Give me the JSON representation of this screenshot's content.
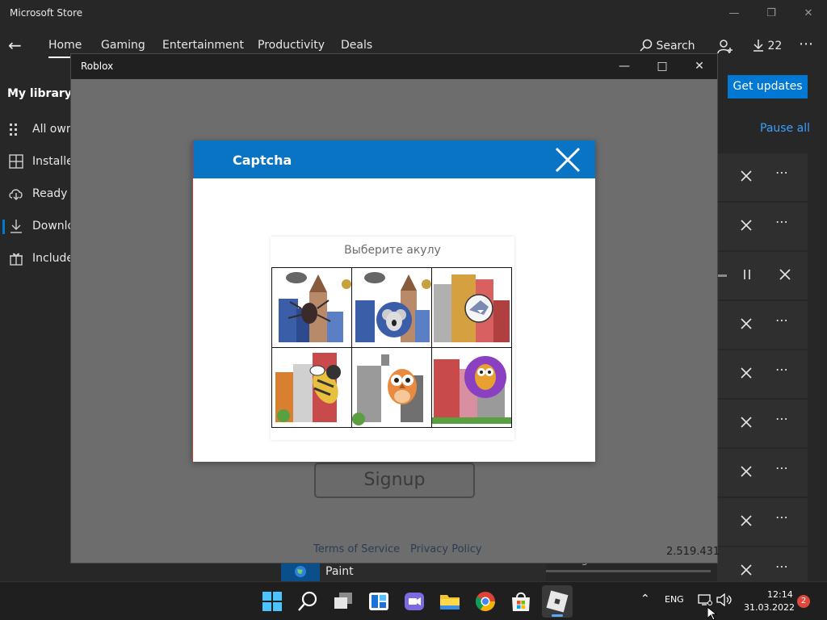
{
  "store": {
    "title": "Microsoft Store",
    "nav": {
      "tabs": [
        "Home",
        "Gaming",
        "Entertainment",
        "Productivity",
        "Deals"
      ],
      "search_label": "Search",
      "downloads_count": "22"
    },
    "sidebar": {
      "title": "My library",
      "items": [
        {
          "label": "All owned",
          "icon": "grid-icon"
        },
        {
          "label": "Installed",
          "icon": "installed-icon"
        },
        {
          "label": "Ready to install",
          "icon": "cloud-download-icon"
        },
        {
          "label": "Downloads",
          "icon": "download-icon"
        },
        {
          "label": "Included",
          "icon": "gift-icon"
        }
      ]
    },
    "get_updates_label": "Get updates",
    "pause_all_label": "Pause all",
    "bottom_app_name": "Paint",
    "pending_label": "Pending"
  },
  "roblox": {
    "title": "Roblox",
    "signup_label": "Signup",
    "footer": {
      "terms": "Terms of Service",
      "privacy": "Privacy Policy"
    },
    "version": "2.519.431"
  },
  "captcha": {
    "title": "Captcha",
    "prompt": "Выберите акулу",
    "tiles": [
      {
        "subject": "spider-icon"
      },
      {
        "subject": "koala-icon"
      },
      {
        "subject": "shark-icon"
      },
      {
        "subject": "bee-icon"
      },
      {
        "subject": "owl-icon"
      },
      {
        "subject": "owl-in-bubble-icon"
      }
    ]
  },
  "taskbar": {
    "lang": "ENG",
    "time": "12:14",
    "date": "31.03.2022",
    "notification_count": "2"
  },
  "colors": {
    "accent": "#0078d4",
    "captcha_header": "#0a74c4",
    "notification": "#e0483e"
  }
}
